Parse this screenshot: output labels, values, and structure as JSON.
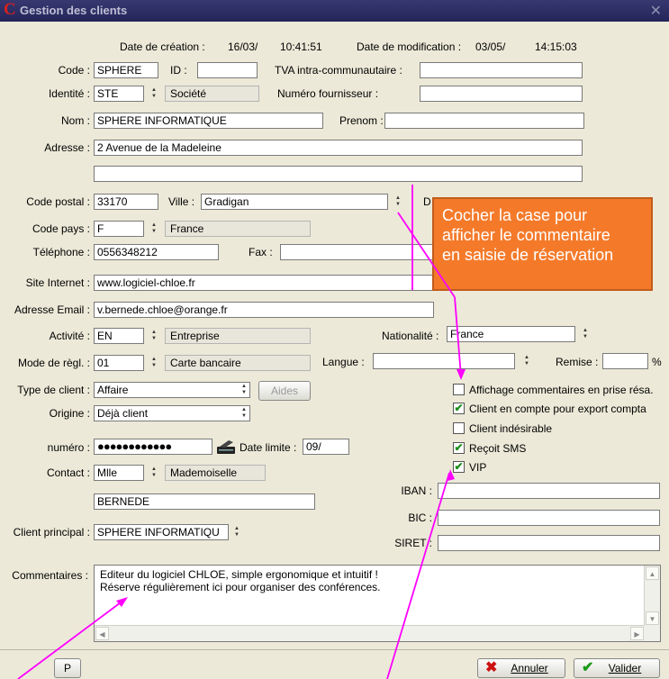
{
  "window": {
    "title": "Gestion des clients",
    "close": "✕",
    "logo": "C"
  },
  "meta": {
    "creation_label": "Date de création :",
    "creation_date": "16/03/",
    "creation_time": "10:41:51",
    "modif_label": "Date de modification :",
    "modif_date": "03/05/",
    "modif_time": "14:15:03"
  },
  "form": {
    "code_label": "Code :",
    "code": "SPHERE",
    "id_label": "ID :",
    "id": "",
    "tva_label": "TVA intra-communautaire :",
    "tva": "",
    "identite_label": "Identité :",
    "identite": "STE",
    "identite_desc": "Société",
    "fournisseur_label": "Numéro fournisseur :",
    "fournisseur": "",
    "nom_label": "Nom :",
    "nom": "SPHERE INFORMATIQUE",
    "prenom_label": "Prenom :",
    "prenom": "",
    "adresse_label": "Adresse :",
    "adresse1": "2 Avenue de la Madeleine",
    "adresse2": "",
    "cp_label": "Code postal :",
    "cp": "33170",
    "ville_label": "Ville :",
    "ville": "Gradigan",
    "hidden_label_partial": "D",
    "pays_label": "Code pays :",
    "pays": "F",
    "pays_desc": "France",
    "tel_label": "Téléphone :",
    "tel": "0556348212",
    "fax_label": "Fax :",
    "fax": "",
    "site_label": "Site Internet :",
    "site": "www.logiciel-chloe.fr",
    "email_label": "Adresse Email :",
    "email": "v.bernede.chloe@orange.fr",
    "activite_label": "Activité :",
    "activite": "EN",
    "activite_desc": "Entreprise",
    "nationalite_label": "Nationalité :",
    "nationalite": "France",
    "reglement_label": "Mode de règl. :",
    "reglement": "01",
    "reglement_desc": "Carte bancaire",
    "langue_label": "Langue :",
    "langue": "",
    "remise_label": "Remise :",
    "remise": "",
    "remise_unit": "%",
    "type_label": "Type de client :",
    "type": "Affaire",
    "aides_button": "Aides",
    "origine_label": "Origine :",
    "origine": "Déjà client",
    "numero_label": "numéro :",
    "numero": "●●●●●●●●●●●●",
    "date_limite_label": "Date limite :",
    "date_limite": "09/",
    "contact_label": "Contact :",
    "contact": "Mlle",
    "contact_desc": "Mademoiselle",
    "contact_name": "BERNEDE",
    "client_principal_label": "Client principal :",
    "client_principal": "SPHERE INFORMATIQU",
    "iban_label": "IBAN :",
    "iban": "",
    "bic_label": "BIC :",
    "bic": "",
    "siret_label": "SIRET :",
    "siret": "",
    "commentaires_label": "Commentaires :",
    "commentaire_line1": "Editeur du logiciel CHLOE, simple ergonomique et intuitif !",
    "commentaire_line2": "Réserve régulièrement ici pour organiser des conférences."
  },
  "checkboxes": [
    {
      "label": "Affichage commentaires en prise résa.",
      "checked": false
    },
    {
      "label": "Client en compte pour export compta",
      "checked": true
    },
    {
      "label": "Client indésirable",
      "checked": false
    },
    {
      "label": "Reçoit SMS",
      "checked": true
    },
    {
      "label": "VIP",
      "checked": true
    }
  ],
  "callout": {
    "line1": "Cocher la case pour",
    "line2": "afficher le commentaire",
    "line3": "en saisie de réservation"
  },
  "buttons": {
    "p": "P",
    "annuler": "Annuler",
    "valider": "Valider"
  },
  "colors": {
    "title_bar": "#2b2d63",
    "callout": "#f47a2a",
    "arrow": "#ff00ff",
    "check": "#1b8f1b"
  }
}
